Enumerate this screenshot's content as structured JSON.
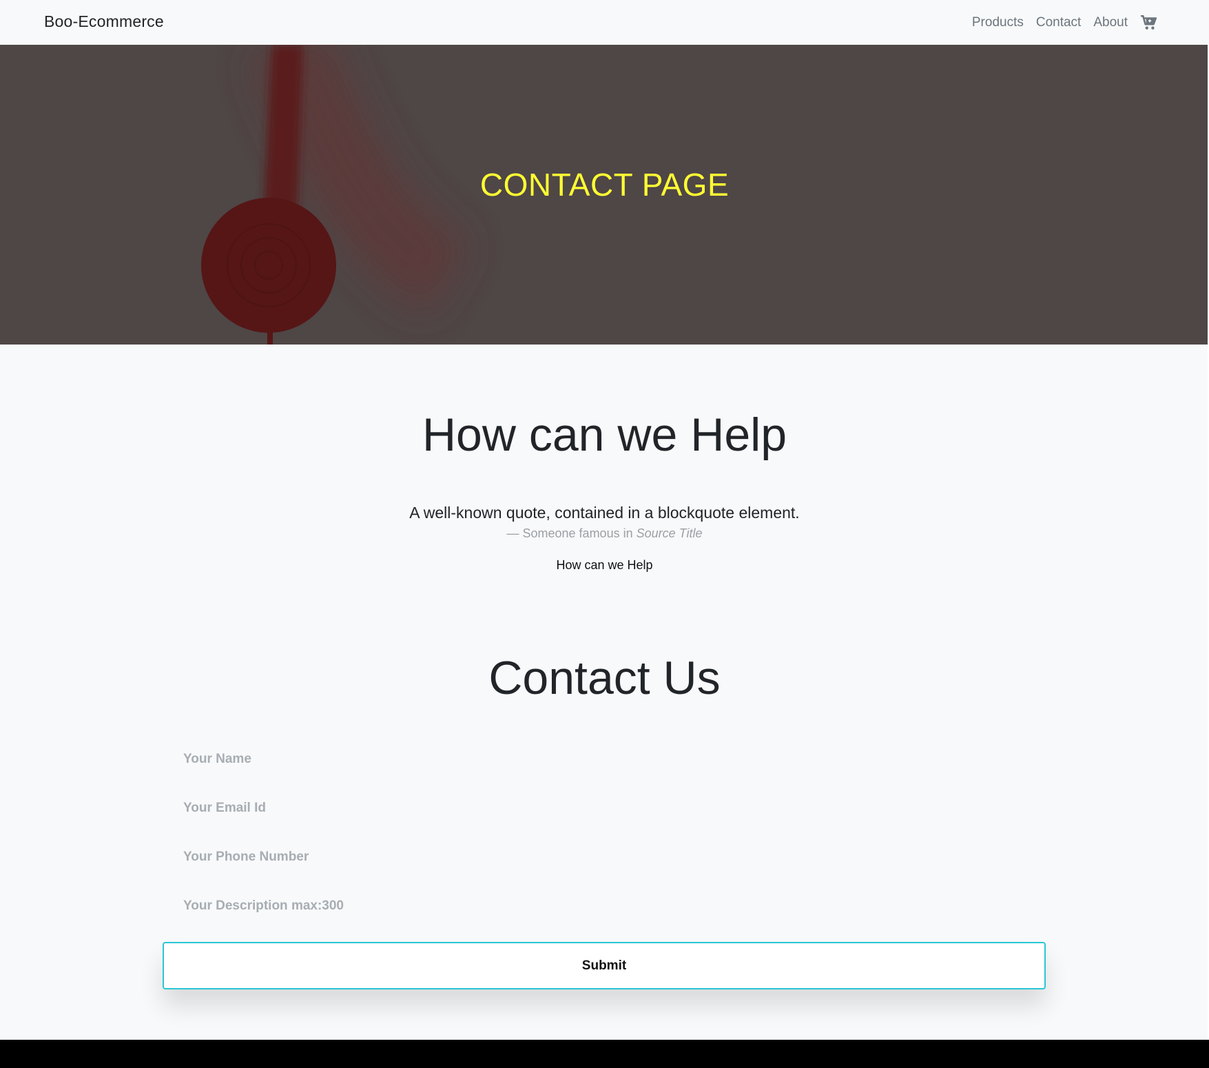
{
  "navbar": {
    "brand": "Boo-Ecommerce",
    "links": [
      "Products",
      "Contact",
      "About"
    ],
    "cart_icon": "shopping-cart-icon"
  },
  "hero": {
    "title": "CONTACT PAGE",
    "background_color": "#4f4646",
    "title_color": "#ffff33"
  },
  "help": {
    "heading": "How can we Help",
    "quote": "A well-known quote, contained in a blockquote element.",
    "quote_author": "— Someone famous in ",
    "quote_source": "Source Title",
    "subheading": "How can we Help"
  },
  "contact": {
    "heading": "Contact Us",
    "name_placeholder": "Your Name",
    "email_placeholder": "Your Email Id",
    "phone_placeholder": "Your Phone Number",
    "description_placeholder": "Your Description max:300",
    "submit_label": "Submit",
    "submit_border_color": "#29c7d3"
  }
}
